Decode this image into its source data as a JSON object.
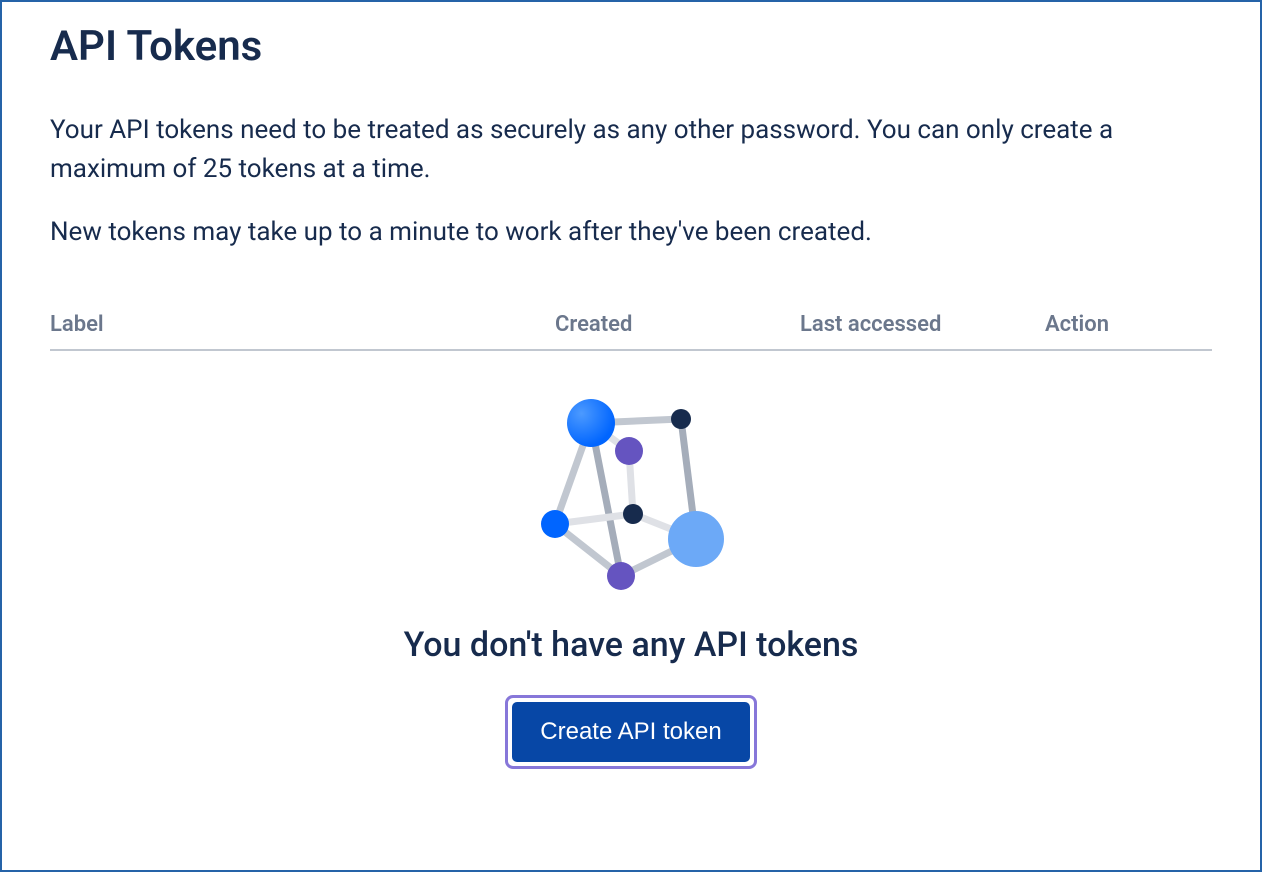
{
  "page": {
    "title": "API Tokens"
  },
  "description": {
    "paragraph1": "Your API tokens need to be treated as securely as any other password. You can only create a maximum of 25 tokens at a time.",
    "paragraph2": "New tokens may take up to a minute to work after they've been created."
  },
  "table": {
    "headers": {
      "label": "Label",
      "created": "Created",
      "last_accessed": "Last accessed",
      "action": "Action"
    }
  },
  "empty_state": {
    "title": "You don't have any API tokens",
    "button_label": "Create API token"
  }
}
